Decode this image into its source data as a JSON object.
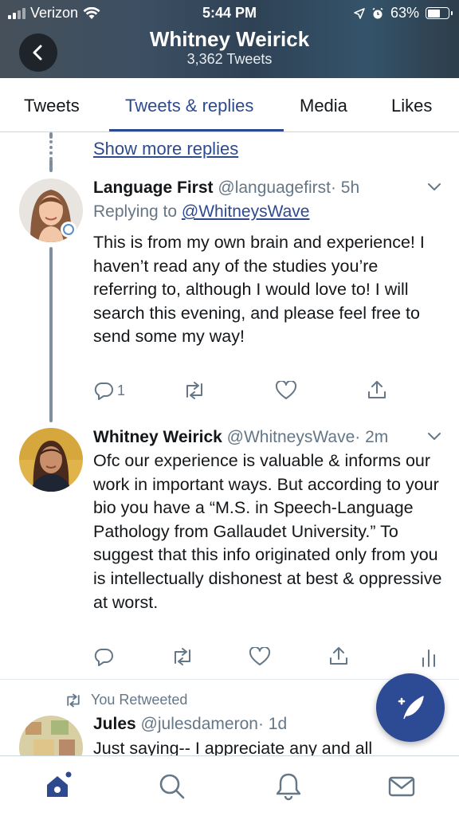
{
  "status_bar": {
    "carrier": "Verizon",
    "time": "5:44 PM",
    "battery": "63%",
    "battery_level": 0.63
  },
  "header": {
    "back_icon": "chevron-left-icon",
    "name": "Whitney Weirick",
    "tweet_count": "3,362 Tweets"
  },
  "tabs": [
    {
      "label": "Tweets",
      "active": false
    },
    {
      "label": "Tweets & replies",
      "active": true
    },
    {
      "label": "Media",
      "active": false
    },
    {
      "label": "Likes",
      "active": false
    }
  ],
  "thread": {
    "show_more": "Show more replies"
  },
  "tweets": [
    {
      "name": "Language First",
      "handle": "@languagefirst",
      "time": "· 5h",
      "replying_prefix": "Replying to ",
      "replying_to": "@WhitneysWave",
      "text": "This is from my own brain and experience! I haven’t read any of the studies you’re referring to, although I would love to! I will search this evening, and please feel free to send some my way!",
      "reply_count": "1"
    },
    {
      "name": "Whitney Weirick",
      "handle": "@WhitneysWave",
      "time": "· 2m",
      "text": "Ofc our experience is valuable & informs our work in important ways. But according to your bio you have a “M.S. in Speech-Language Pathology from Gallaudet University.” To suggest that this info originated only from you is intellectually dishonest at best & oppressive at worst."
    },
    {
      "retweet_label": "You Retweeted",
      "name": "Jules",
      "handle": "@julesdameron",
      "time": "· 1d",
      "text": "Just saying-- I appreciate any and all"
    }
  ],
  "colors": {
    "accent": "#2e4a8f",
    "secondary_text": "#657786",
    "fab": "#2d4b94"
  }
}
